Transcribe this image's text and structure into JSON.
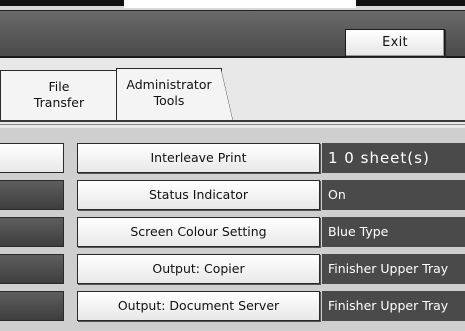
{
  "header": {
    "exit_label": "Exit"
  },
  "tabs": [
    {
      "label_line1": "File",
      "label_line2": "Transfer"
    },
    {
      "label_line1": "Administrator",
      "label_line2": "Tools"
    }
  ],
  "settings": [
    {
      "label": "Interleave Print",
      "value": "1 0 sheet(s)"
    },
    {
      "label": "Status Indicator",
      "value": "On"
    },
    {
      "label": "Screen Colour Setting",
      "value": "Blue Type"
    },
    {
      "label": "Output: Copier",
      "value": "Finisher Upper Tray"
    },
    {
      "label": "Output: Document Server",
      "value": "Finisher Upper Tray"
    }
  ]
}
